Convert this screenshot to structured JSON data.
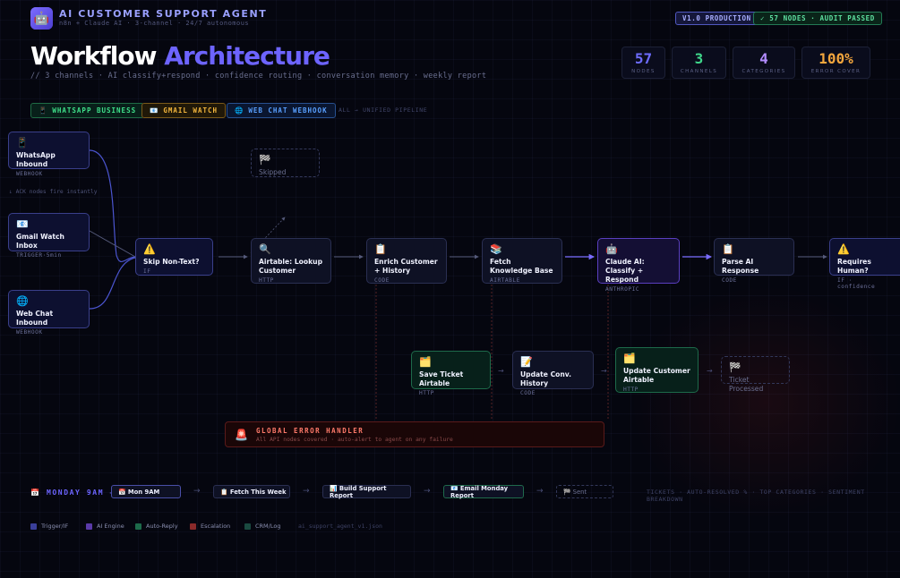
{
  "header": {
    "logo_icon": "robot-icon",
    "title": "AI CUSTOMER SUPPORT AGENT",
    "subtitle": "n8n + Claude AI · 3-channel · 24/7 autonomous",
    "version_badge": "V1.0 PRODUCTION",
    "audit_badge": "✓ 57 NODES · AUDIT PASSED"
  },
  "hero": {
    "title_main": "Workflow",
    "title_accent": "Architecture",
    "tagline": "// 3 channels · AI classify+respond · confidence routing · conversation memory · weekly report"
  },
  "stats": [
    {
      "value": "57",
      "label": "NODES",
      "color": "#6d6cff"
    },
    {
      "value": "3",
      "label": "CHANNELS",
      "color": "#3fd68a"
    },
    {
      "value": "4",
      "label": "CATEGORIES",
      "color": "#b38cff"
    },
    {
      "value": "100%",
      "label": "ERROR COVER",
      "color": "#f3a63d"
    }
  ],
  "channels": {
    "whatsapp": "WHATSAPP BUSINESS",
    "gmail": "GMAIL WATCH",
    "webchat": "WEB CHAT WEBHOOK",
    "note": "ALL → UNIFIED PIPELINE"
  },
  "triggers": [
    {
      "icon": "📱",
      "title": "WhatsApp Inbound",
      "sub": "WEBHOOK"
    },
    {
      "icon": "📧",
      "title": "Gmail Watch Inbox",
      "sub": "TRIGGER·5min"
    },
    {
      "icon": "🌐",
      "title": "Web Chat Inbound",
      "sub": "WEBHOOK"
    }
  ],
  "ack_note": "↓ ACK nodes fire instantly",
  "skipped": {
    "icon": "🏁",
    "title": "Skipped"
  },
  "pipeline": [
    {
      "icon": "⚠️",
      "title": "Skip Non-Text?",
      "sub": "IF"
    },
    {
      "icon": "🔍",
      "title": "Airtable: Lookup Customer",
      "sub": "HTTP"
    },
    {
      "icon": "📋",
      "title": "Enrich Customer + History",
      "sub": "CODE"
    },
    {
      "icon": "📚",
      "title": "Fetch Knowledge Base",
      "sub": "AIRTABLE"
    },
    {
      "icon": "🤖",
      "title": "Claude AI: Classify + Respond",
      "sub": "ANTHROPIC"
    },
    {
      "icon": "📋",
      "title": "Parse AI Response",
      "sub": "CODE"
    },
    {
      "icon": "⚠️",
      "title": "Requires Human?",
      "sub": "IF · confidence"
    }
  ],
  "post": [
    {
      "icon": "🗂️",
      "title": "Save Ticket Airtable",
      "sub": "HTTP"
    },
    {
      "icon": "📝",
      "title": "Update Conv. History",
      "sub": "CODE"
    },
    {
      "icon": "🗂️",
      "title": "Update Customer Airtable",
      "sub": "HTTP"
    },
    {
      "icon": "🏁",
      "title": "Ticket Processed",
      "sub": ""
    }
  ],
  "error_handler": {
    "icon": "🚨",
    "title": "GLOBAL ERROR HANDLER",
    "sub": "All API nodes covered · auto-alert to agent on any failure"
  },
  "monday": {
    "label": "📅 MONDAY 9AM →",
    "nodes": [
      "📅 Mon 9AM",
      "📋 Fetch This Week",
      "📊 Build Support Report",
      "📧 Email Monday Report",
      "🏁 Sent"
    ],
    "note": "TICKETS · AUTO-RESOLVED % · TOP CATEGORIES · SENTIMENT BREAKDOWN"
  },
  "legend": [
    {
      "label": "Trigger/IF",
      "color": "#3a3f9a"
    },
    {
      "label": "AI Engine",
      "color": "#5a3aa8"
    },
    {
      "label": "Auto-Reply",
      "color": "#1d6a4a"
    },
    {
      "label": "Escalation",
      "color": "#8a2a2a"
    },
    {
      "label": "CRM/Log",
      "color": "#1a4a40"
    }
  ],
  "filename": "ai_support_agent_v1.json"
}
